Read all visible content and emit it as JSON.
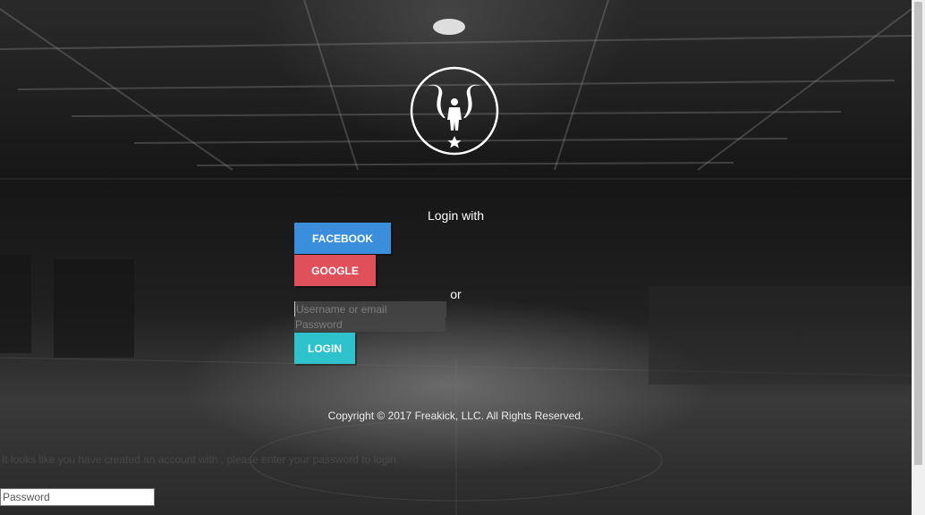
{
  "login": {
    "heading": "Login with",
    "facebook_label": "FACEBOOK",
    "google_label": "GOOGLE",
    "or_label": "or",
    "username_placeholder": "Username or email",
    "password_placeholder": "Password",
    "login_label": "LOGIN"
  },
  "footer": {
    "copyright": "Copyright © 2017 Freakick, LLC. All Rights Reserved."
  },
  "hidden_form": {
    "message": "It looks like you have created an account with , please enter your password to login.",
    "password_placeholder": "Password"
  },
  "colors": {
    "facebook": "#3b8edb",
    "google": "#e0505a",
    "login": "#2ec3cc"
  },
  "icons": {
    "logo": "trophy-player-star-emblem"
  }
}
